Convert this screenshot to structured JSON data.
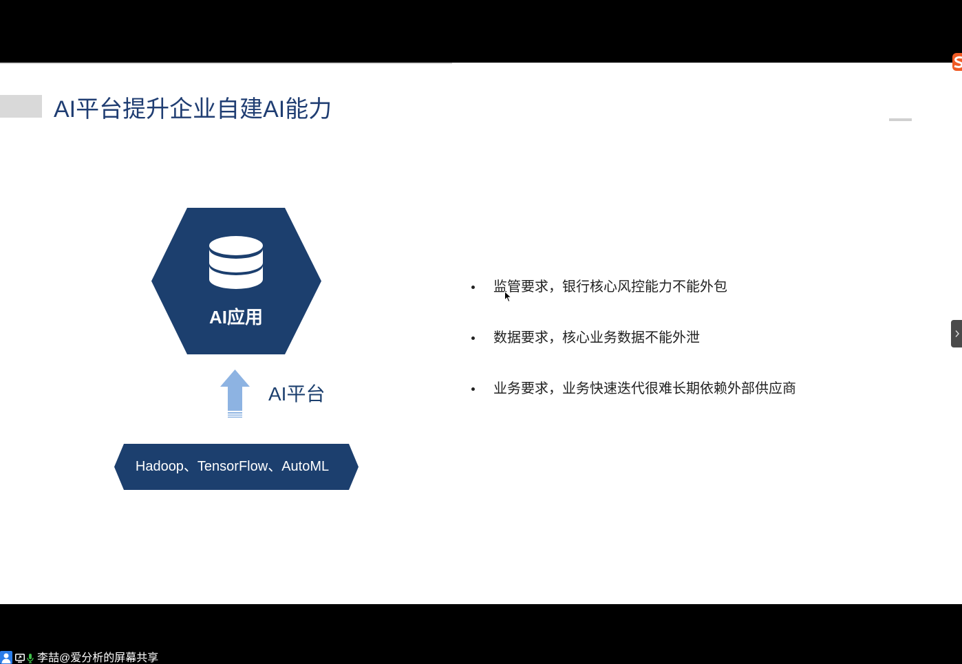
{
  "slide": {
    "title": "AI平台提升企业自建AI能力",
    "diagram": {
      "hexagon_label": "AI应用",
      "platform_label": "AI平台",
      "base_label": "Hadoop、TensorFlow、AutoML"
    },
    "bullets": [
      "监管要求，银行核心风控能力不能外包",
      "数据要求，核心业务数据不能外泄",
      "业务要求，业务快速迭代很难长期依赖外部供应商"
    ]
  },
  "share_bar": {
    "label": "李喆@爱分析的屏幕共享"
  },
  "icons": {
    "input_method": "sogou-ime-icon",
    "hexagon": "database-icon",
    "arrow": "arrow-up-icon",
    "cursor": "mouse-cursor-icon",
    "side_panel": "chevron-right-icon",
    "user": "user-icon",
    "share": "screen-share-icon",
    "mic": "microphone-icon"
  },
  "colors": {
    "navy": "#1c3f6e",
    "title": "#1f3d72",
    "arrow": "#8db3e2",
    "text": "#222222",
    "accent_gray": "#d9d9d9",
    "side_tab": "#4a4a4a",
    "sogou_orange": "#ef5a24",
    "user_blue": "#2b7de9",
    "mic_green": "#3fbf4a"
  }
}
